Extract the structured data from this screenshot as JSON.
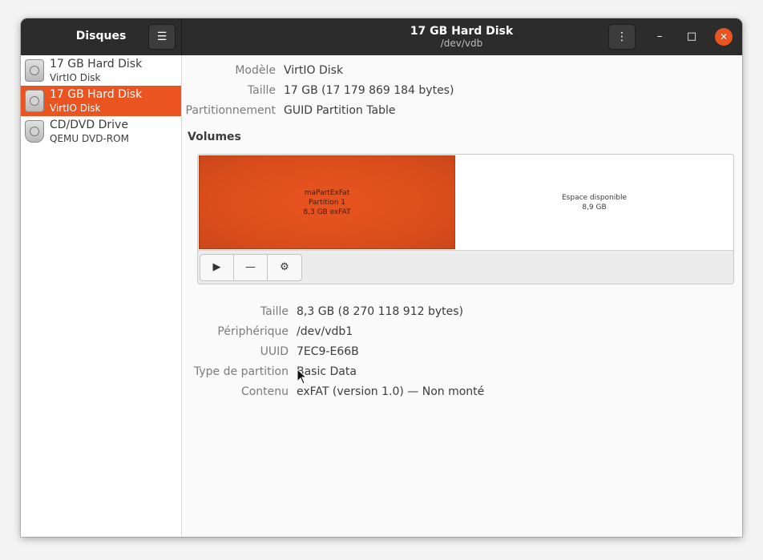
{
  "header": {
    "app_title": "Disques",
    "menu_icon": "hamburger-menu-icon",
    "title": "17 GB Hard Disk",
    "subtitle": "/dev/vdb",
    "kebab_icon": "vertical-dots-icon",
    "min_glyph": "–",
    "max_glyph": "□",
    "close_glyph": "✕"
  },
  "sidebar": {
    "items": [
      {
        "name": "17 GB Hard Disk",
        "sub": "VirtIO Disk",
        "icon": "hard-disk-icon"
      },
      {
        "name": "17 GB Hard Disk",
        "sub": "VirtIO Disk",
        "icon": "hard-disk-icon"
      },
      {
        "name": "CD/DVD Drive",
        "sub": "QEMU DVD-ROM",
        "icon": "optical-drive-icon"
      }
    ]
  },
  "disk": {
    "model_label": "Modèle",
    "model": "VirtIO Disk",
    "size_label": "Taille",
    "size": "17 GB (17 179 869 184 bytes)",
    "partitioning_label": "Partitionnement",
    "partitioning": "GUID Partition Table"
  },
  "volumes": {
    "title": "Volumes",
    "partition": {
      "name": "maPartExFat",
      "number": "Partition 1",
      "info": "8,3 GB exFAT"
    },
    "free": {
      "label": "Espace disponible",
      "size": "8,9 GB"
    },
    "toolbar": {
      "mount_icon": "play-icon",
      "remove_icon": "minus-icon",
      "settings_icon": "gears-icon",
      "mount_glyph": "▶",
      "remove_glyph": "—",
      "settings_glyph": "⚙"
    }
  },
  "partition_details": {
    "size_label": "Taille",
    "size": "8,3 GB (8 270 118 912 bytes)",
    "device_label": "Périphérique",
    "device": "/dev/vdb1",
    "uuid_label": "UUID",
    "uuid": "7EC9-E66B",
    "type_label": "Type de partition",
    "type": "Basic Data",
    "content_label": "Contenu",
    "content": "exFAT (version 1.0) — Non monté"
  },
  "colors": {
    "accent": "#e95420",
    "header_bg": "#2c2c2c"
  }
}
